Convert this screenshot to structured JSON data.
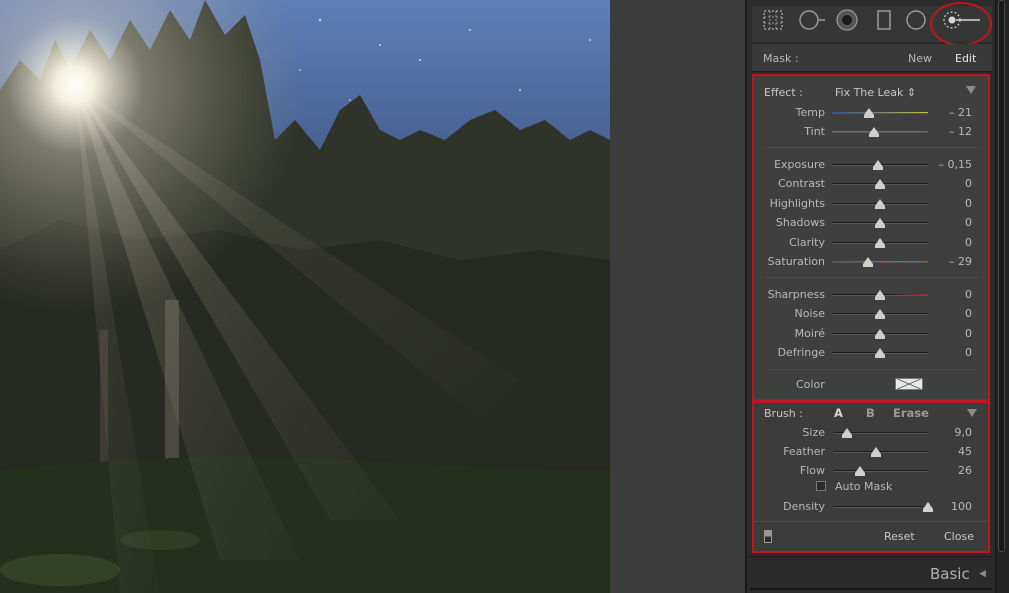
{
  "mask": {
    "label": "Mask :",
    "new": "New",
    "edit": "Edit"
  },
  "effect": {
    "label": "Effect :",
    "preset": "Fix The Leak ⇕",
    "groups": [
      [
        {
          "name": "Temp",
          "value": "– 21",
          "level": 0.39,
          "track": "temp"
        },
        {
          "name": "Tint",
          "value": "– 12",
          "level": 0.44,
          "track": "tint"
        }
      ],
      [
        {
          "name": "Exposure",
          "value": "– 0,15",
          "level": 0.48,
          "track": "plain"
        },
        {
          "name": "Contrast",
          "value": "0",
          "level": 0.5,
          "track": "plain"
        },
        {
          "name": "Highlights",
          "value": "0",
          "level": 0.5,
          "track": "plain"
        },
        {
          "name": "Shadows",
          "value": "0",
          "level": 0.5,
          "track": "plain"
        },
        {
          "name": "Clarity",
          "value": "0",
          "level": 0.5,
          "track": "plain"
        },
        {
          "name": "Saturation",
          "value": "– 29",
          "level": 0.37,
          "track": "saturation"
        }
      ],
      [
        {
          "name": "Sharpness",
          "value": "0",
          "level": 0.5,
          "track": "sharp"
        },
        {
          "name": "Noise",
          "value": "0",
          "level": 0.5,
          "track": "plain"
        },
        {
          "name": "Moiré",
          "value": "0",
          "level": 0.5,
          "track": "plain"
        },
        {
          "name": "Defringe",
          "value": "0",
          "level": 0.5,
          "track": "plain"
        }
      ]
    ],
    "color_label": "Color"
  },
  "brush": {
    "label": "Brush :",
    "options": [
      "A",
      "B",
      "Erase"
    ],
    "sliders": [
      {
        "name": "Size",
        "value": "9,0",
        "level": 0.14
      },
      {
        "name": "Feather",
        "value": "45",
        "level": 0.45
      },
      {
        "name": "Flow",
        "value": "26",
        "level": 0.28
      }
    ],
    "auto_mask": "Auto Mask",
    "density": {
      "name": "Density",
      "value": "100",
      "level": 1.0
    }
  },
  "footer": {
    "reset": "Reset",
    "close": "Close"
  },
  "basic": {
    "label": "Basic"
  },
  "tools": [
    "crop-overlay-icon",
    "spot-removal-icon",
    "red-eye-icon",
    "graduated-filter-icon",
    "radial-filter-icon",
    "adjustment-brush-icon"
  ],
  "colors": {
    "highlight_ring": "#c0151c",
    "panel": "#2c2c2c",
    "text": "#b8b8b8"
  }
}
